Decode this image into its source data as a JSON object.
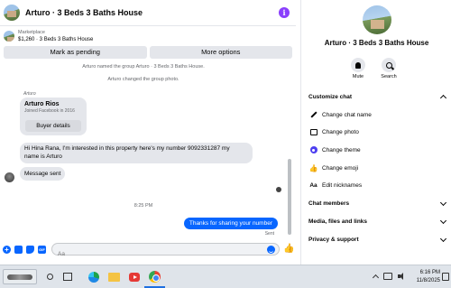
{
  "header": {
    "title": "Arturo · 3 Beds 3 Baths House"
  },
  "marketplace": {
    "label": "Marketplace",
    "item": "$1,260 · 3 Beds 3 Baths House"
  },
  "actions": {
    "mark_pending": "Mark as pending",
    "more_options": "More options"
  },
  "messages": {
    "system1": "Arturo named the group Arturo · 3 Beds 3 Baths House.",
    "system2": "Arturo changed the group photo.",
    "sender": "Arturo",
    "card": {
      "name": "Arturo Rios",
      "joined": "Joined Facebook in 2016",
      "button": "Buyer details"
    },
    "msg1_line1": "Hi Hina Rana, I'm interested in this property here's my number 9092331287 my",
    "msg1_line2": "name is Arturo",
    "msg2": "Message sent",
    "time": "8:25 PM",
    "outgoing": "Thanks for sharing your number",
    "status": "Sent"
  },
  "composer": {
    "placeholder": "Aa",
    "value": ""
  },
  "info": {
    "name": "Arturo · 3 Beds 3 Baths House",
    "mute": "Mute",
    "search": "Search",
    "customize": "Customize chat",
    "options": [
      "Change chat name",
      "Change photo",
      "Change theme",
      "Change emoji",
      "Edit nicknames"
    ],
    "members": "Chat members",
    "media": "Media, files and links",
    "privacy": "Privacy & support"
  },
  "taskbar": {
    "time": "6:16 PM",
    "date": "11/8/2025"
  },
  "colors": {
    "accent": "#0866ff",
    "info_icon": "#8a3ffc",
    "theme": "#4d3ff0"
  }
}
